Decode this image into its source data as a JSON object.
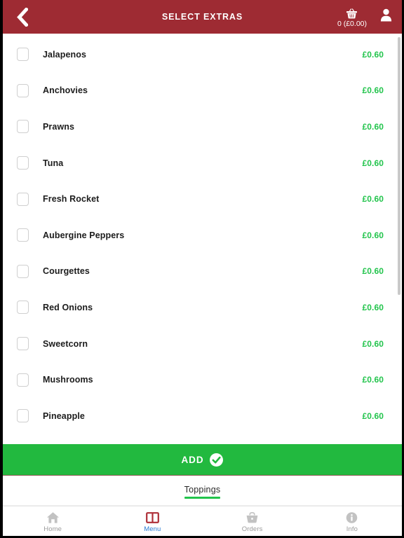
{
  "header": {
    "title": "SELECT EXTRAS",
    "back_icon": "chevron-left-icon",
    "basket_icon": "basket-icon",
    "basket_summary": "0 (£0.00)",
    "user_icon": "user-icon",
    "background_color": "#9E2B33"
  },
  "extras": {
    "items": [
      {
        "name": "Jalapenos",
        "price": "£0.60",
        "checked": false
      },
      {
        "name": "Anchovies",
        "price": "£0.60",
        "checked": false
      },
      {
        "name": "Prawns",
        "price": "£0.60",
        "checked": false
      },
      {
        "name": "Tuna",
        "price": "£0.60",
        "checked": false
      },
      {
        "name": "Fresh Rocket",
        "price": "£0.60",
        "checked": false
      },
      {
        "name": "Aubergine Peppers",
        "price": "£0.60",
        "checked": false
      },
      {
        "name": "Courgettes",
        "price": "£0.60",
        "checked": false
      },
      {
        "name": "Red Onions",
        "price": "£0.60",
        "checked": false
      },
      {
        "name": "Sweetcorn",
        "price": "£0.60",
        "checked": false
      },
      {
        "name": "Mushrooms",
        "price": "£0.60",
        "checked": false
      },
      {
        "name": "Pineapple",
        "price": "£0.60",
        "checked": false
      }
    ],
    "price_color": "#22C44C"
  },
  "add_button": {
    "label": "ADD",
    "icon": "check-circle-icon",
    "background_color": "#22B93F"
  },
  "tabs": {
    "items": [
      {
        "label": "Toppings",
        "active": true
      }
    ],
    "active_underline_color": "#22C44C"
  },
  "bottom_nav": {
    "items": [
      {
        "label": "Home",
        "icon": "home-icon",
        "active": false
      },
      {
        "label": "Menu",
        "icon": "book-icon",
        "active": true
      },
      {
        "label": "Orders",
        "icon": "basket-icon",
        "active": false
      },
      {
        "label": "Info",
        "icon": "info-icon",
        "active": false
      }
    ],
    "active_color": "#2b7cd3",
    "inactive_color": "#9a9a9a"
  }
}
